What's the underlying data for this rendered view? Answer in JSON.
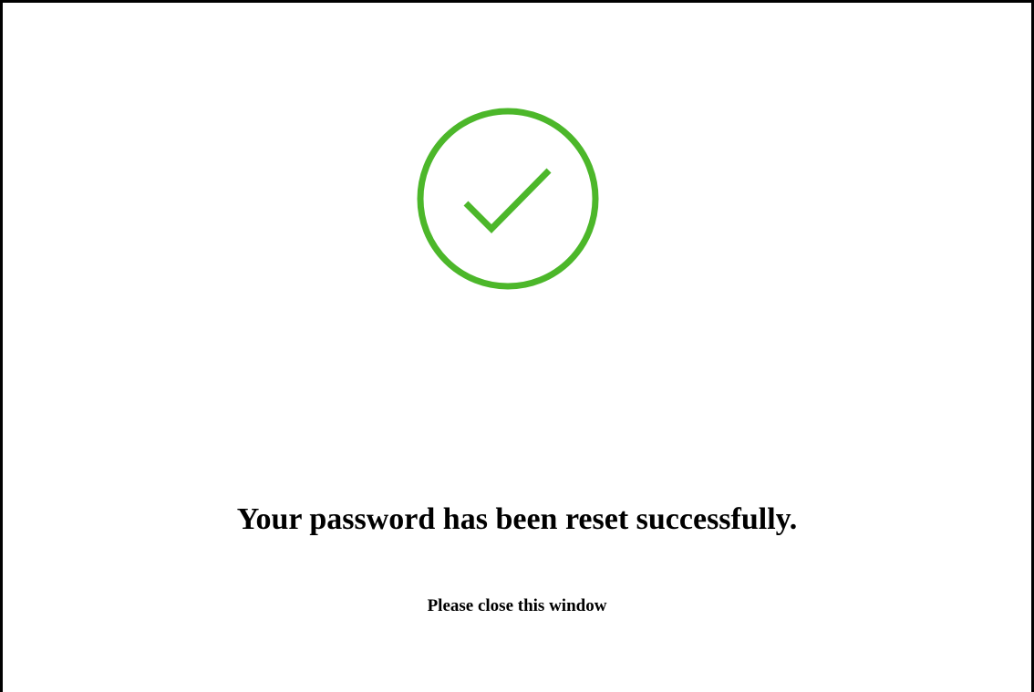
{
  "status": {
    "icon": "check-circle-icon",
    "color": "#4cb72a",
    "title": "Your password has been reset successfully.",
    "message": "Please close this window"
  }
}
